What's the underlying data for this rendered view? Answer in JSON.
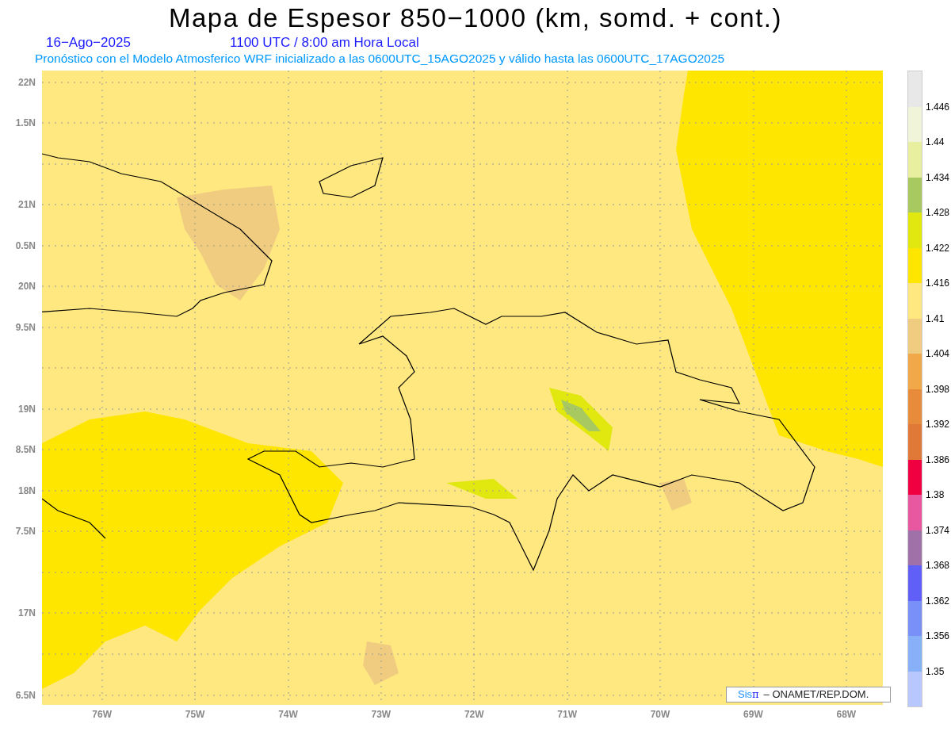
{
  "title": "Mapa de Espesor 850−1000 (km, somd. + cont.)",
  "date": "16−Ago−2025",
  "time": "1100 UTC / 8:00 am Hora Local",
  "subtitle": "Pronóstico con el Modelo Atmosferico WRF inicializado a las 0600UTC_15AGO2025 y válido hasta las  0600UTC_17AGO2025",
  "y_labels": [
    "22N",
    "1.5N",
    "21N",
    "0.5N",
    "20N",
    "9.5N",
    "19N",
    "8.5N",
    "18N",
    "7.5N",
    "17N",
    "6.5N"
  ],
  "x_labels": [
    "76W",
    "75W",
    "74W",
    "73W",
    "72W",
    "71W",
    "70W",
    "69W",
    "68W"
  ],
  "legend": [
    {
      "color": "#e8e8e8",
      "label": "1.446"
    },
    {
      "color": "#f0f4d8",
      "label": "1.44"
    },
    {
      "color": "#e8f0a0",
      "label": "1.434"
    },
    {
      "color": "#a8c860",
      "label": "1.428"
    },
    {
      "color": "#e0e810",
      "label": "1.422"
    },
    {
      "color": "#ffe600",
      "label": "1.416"
    },
    {
      "color": "#ffe880",
      "label": "1.41"
    },
    {
      "color": "#f0cc80",
      "label": "1.404"
    },
    {
      "color": "#f0a848",
      "label": "1.398"
    },
    {
      "color": "#e88c3c",
      "label": "1.392"
    },
    {
      "color": "#e07838",
      "label": "1.386"
    },
    {
      "color": "#f00040",
      "label": "1.38"
    },
    {
      "color": "#e858a0",
      "label": "1.374"
    },
    {
      "color": "#a070a8",
      "label": "1.368"
    },
    {
      "color": "#6060f8",
      "label": "1.362"
    },
    {
      "color": "#7890f8",
      "label": "1.356"
    },
    {
      "color": "#88b0f8",
      "label": "1.35"
    },
    {
      "color": "#b8c8ff"
    }
  ],
  "credit": {
    "brand": "Sis",
    "symbol": "π",
    "text": "– ONAMET/REP.DOM."
  }
}
